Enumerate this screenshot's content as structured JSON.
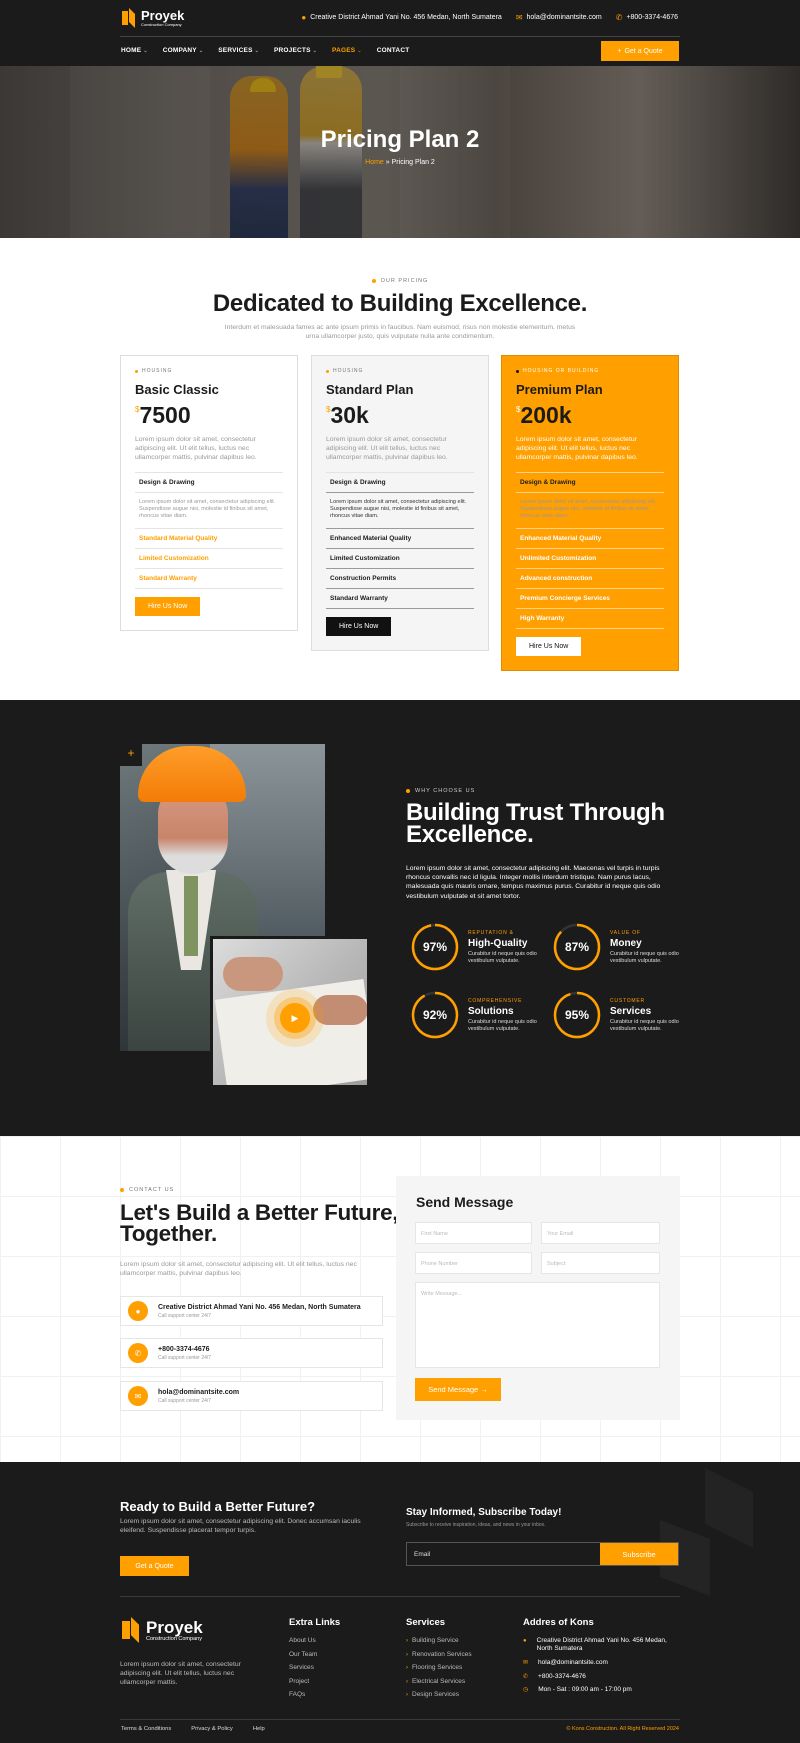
{
  "header": {
    "logo_name": "Proyek",
    "logo_tagline": "Construction Company",
    "address": "Creative District Ahmad Yani No. 456 Medan, North Sumatera",
    "email": "hola@dominantsite.com",
    "phone": "+800-3374-4676",
    "nav": [
      "HOME",
      "COMPANY",
      "SERVICES",
      "PROJECTS",
      "PAGES",
      "CONTACT"
    ],
    "cta": "Get a Quote"
  },
  "hero": {
    "title": "Pricing Plan 2",
    "crumb_home": "Home",
    "crumb_sep": " » ",
    "crumb_current": "Pricing Plan 2"
  },
  "pricing": {
    "eyebrow": "OUR PRICING",
    "title": "Dedicated to Building Excellence.",
    "lead": "Interdum et malesuada fames ac ante ipsum primis in faucibus. Nam euismod, risus non molestie elementum, metus urna ullamcorper justo, quis vulputate nulla ante condimentum.",
    "plans": [
      {
        "tag": "HOUSING",
        "name": "Basic Classic",
        "currency": "$",
        "price": "7500",
        "desc": "Lorem ipsum dolor sit amet, consectetur adipiscing elit. Ut elit tellus, luctus nec ullamcorper mattis, pulvinar dapibus leo.",
        "features_title": "Design & Drawing",
        "features_desc": "Lorem ipsum dolor sit amet, consectetur adipiscing elit. Suspendisse augue nisi, molestie id finibus sit amet, rhoncus vitae diam.",
        "features": [
          "Standard Material Quality",
          "Limited Customization",
          "Standard Warranty"
        ],
        "button": "Hire Us Now"
      },
      {
        "tag": "HOUSING",
        "name": "Standard Plan",
        "currency": "$",
        "price": "30k",
        "desc": "Lorem ipsum dolor sit amet, consectetur adipiscing elit. Ut elit tellus, luctus nec ullamcorper mattis, pulvinar dapibus leo.",
        "features_title": "Design & Drawing",
        "features_desc": "Lorem ipsum dolor sit amet, consectetur adipiscing elit. Suspendisse augue nisi, molestie id finibus sit amet, rhoncus vitae diam.",
        "features": [
          "Enhanced Material Quality",
          "Limited Customization",
          "Construction Permits",
          "Standard Warranty"
        ],
        "button": "Hire Us Now"
      },
      {
        "tag": "HOUSING OR BUILDING",
        "name": "Premium Plan",
        "currency": "$",
        "price": "200k",
        "desc": "Lorem ipsum dolor sit amet, consectetur adipiscing elit. Ut elit tellus, luctus nec ullamcorper mattis, pulvinar dapibus leo.",
        "features_title": "Design & Drawing",
        "features_desc": "Lorem ipsum dolor sit amet, consectetur adipiscing elit. Suspendisse augue nisi, molestie id finibus sit amet, rhoncus vitae diam.",
        "features": [
          "Enhanced Material Quality",
          "Unlimited Customization",
          "Advanced construction",
          "Premium Concierge Services",
          "High Warranty"
        ],
        "button": "Hire Us Now"
      }
    ]
  },
  "why": {
    "eyebrow": "WHY CHOOSE US",
    "title": "Building Trust Through Excellence.",
    "lead": "Lorem ipsum dolor sit amet, consectetur adipiscing elit. Maecenas vel turpis in turpis rhoncus convallis nec id ligula. Integer mollis interdum tristique. Nam purus lacus, malesuada quis mauris ornare, tempus maximus purus. Curabitur id neque quis odio vestibulum vulputate et sit amet tortor.",
    "plus": "+",
    "stats": [
      {
        "value": 97,
        "label": "97%",
        "eyebrow": "REPUTATION &",
        "title": "High-Quality",
        "desc": "Curabitur id neque quis odio vestibulum vulputate."
      },
      {
        "value": 87,
        "label": "87%",
        "eyebrow": "VALUE OF",
        "title": "Money",
        "desc": "Curabitur id neque quis odio vestibulum vulputate."
      },
      {
        "value": 92,
        "label": "92%",
        "eyebrow": "COMPREHENSIVE",
        "title": "Solutions",
        "desc": "Curabitur id neque quis odio vestibulum vulputate."
      },
      {
        "value": 95,
        "label": "95%",
        "eyebrow": "CUSTOMER",
        "title": "Services",
        "desc": "Curabitur id neque quis odio vestibulum vulputate."
      }
    ]
  },
  "contact": {
    "eyebrow": "CONTACT US",
    "title": "Let's Build a Better Future, Together.",
    "lead": "Lorem ipsum dolor sit amet, consectetur adipiscing elit. Ut elit tellus, luctus nec ullamcorper mattis, pulvinar dapibus leo.",
    "items": [
      {
        "title": "Creative District Ahmad Yani No. 456 Medan, North Sumatera",
        "sub": "Call support center 24/7"
      },
      {
        "title": "+800-3374-4676",
        "sub": "Call support center 24/7"
      },
      {
        "title": "hola@dominantsite.com",
        "sub": "Call support center 24/7"
      }
    ],
    "form": {
      "title": "Send Message",
      "first_name": "First Name",
      "email": "Your Email",
      "phone": "Phone Number",
      "subject": "Subject",
      "message": "Write Message...",
      "button": "Send Message →"
    }
  },
  "footer": {
    "cta_title": "Ready to Build a Better Future?",
    "cta_text": "Lorem ipsum dolor sit amet, consectetur adipiscing elit. Donec accumsan iaculis eleifend. Suspendisse placerat tempor turpis.",
    "cta_button": "Get a Quote",
    "subscribe_title": "Stay Informed, Subscribe Today!",
    "subscribe_text": "Subscribe to receive inspiration, ideas, and news in your inbox.",
    "email_placeholder": "Email",
    "subscribe_button": "Subscribe",
    "logo_name": "Proyek",
    "logo_tagline": "Construction Company",
    "about": "Lorem ipsum dolor sit amet, consectetur adipiscing elit. Ut elit tellus, luctus nec ullamcorper mattis.",
    "extra_title": "Extra Links",
    "extra_links": [
      "About Us",
      "Our Team",
      "Services",
      "Project",
      "FAQs"
    ],
    "services_title": "Services",
    "services": [
      "Building Service",
      "Renovation Services",
      "Flooring Services",
      "Electrical Services",
      "Design Services"
    ],
    "address_title": "Addres of Kons",
    "address": "Creative District Ahmad Yani No. 456 Medan, North Sumatera",
    "email": "hola@dominantsite.com",
    "phone": "+800-3374-4676",
    "hours": "Mon - Sat : 09:00 am - 17:00 pm",
    "bottom_links": [
      "Terms & Conditions",
      "Privacy & Policy",
      "Help"
    ],
    "copyright": "© Kons Construction. All Right Reserved 2024"
  },
  "colors": {
    "accent": "#ff9f00",
    "dark": "#1b1b1b"
  }
}
